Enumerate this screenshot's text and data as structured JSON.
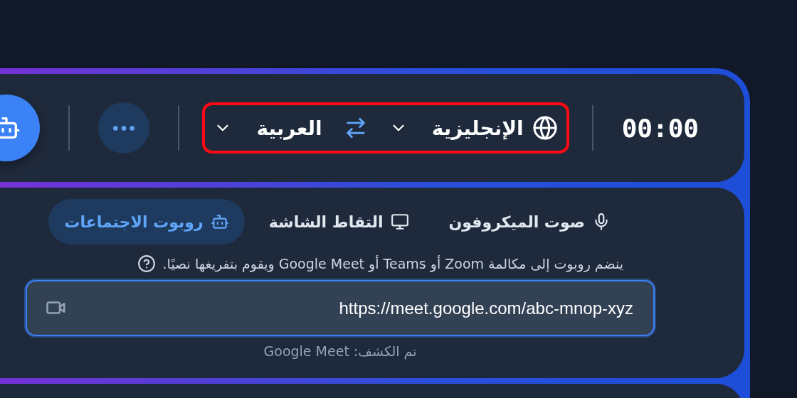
{
  "top_bar": {
    "timer": "00:00",
    "language_selector": {
      "highlighted": true,
      "source": "الإنجليزية",
      "target": "العربية"
    }
  },
  "source_tabs": [
    {
      "kind": "microphone",
      "label": "صوت الميكروفون",
      "selected": false
    },
    {
      "kind": "screen",
      "label": "التقاط الشاشة",
      "selected": false
    },
    {
      "kind": "bot",
      "label": "روبوت الاجتماعات",
      "selected": true
    }
  ],
  "hint": "ينضم روبوت إلى مكالمة Zoom أو Teams أو Google Meet ويقوم بتفريغها نصيًا.",
  "meeting_link": {
    "value": "https://meet.google.com/abc-mnop-xyz",
    "focused": true
  },
  "detected": "تم الكشف: Google Meet"
}
